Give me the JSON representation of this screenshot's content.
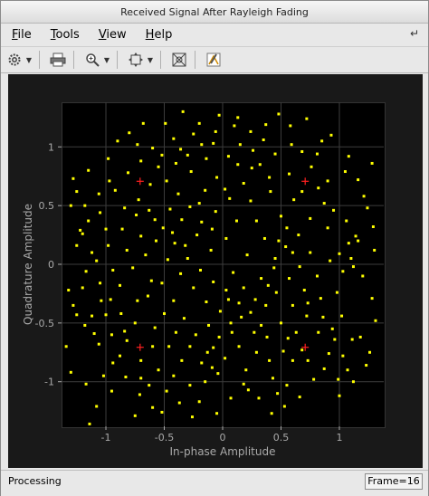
{
  "window": {
    "title": "Received Signal After Rayleigh Fading"
  },
  "menu": [
    {
      "label_u": "F",
      "label_rest": "ile"
    },
    {
      "label_u": "T",
      "label_rest": "ools"
    },
    {
      "label_u": "V",
      "label_rest": "iew"
    },
    {
      "label_u": "H",
      "label_rest": "elp"
    }
  ],
  "toolbar": {
    "icons": [
      "gear-icon",
      "print-icon",
      "zoom-in-icon",
      "fit-to-view-icon",
      "data-cursor-icon",
      "edit-icon"
    ]
  },
  "status": {
    "text": "Processing",
    "frame": "Frame=16"
  },
  "colors": {
    "plot_bg": "#000000",
    "points": "#ffff00",
    "reference": "#ff2020",
    "axis_text": "#aaaaaa"
  },
  "chart_data": {
    "type": "scatter",
    "title": "",
    "xlabel": "In-phase Amplitude",
    "ylabel": "Quadrature Amplitude",
    "xlim": [
      -1.38,
      1.38
    ],
    "ylim": [
      -1.38,
      1.38
    ],
    "xticks": [
      -1,
      -0.5,
      0,
      0.5,
      1
    ],
    "yticks": [
      -1,
      -0.5,
      0,
      0.5,
      1
    ],
    "xtick_labels": [
      "-1",
      "-0.5",
      "0",
      "0.5",
      "1"
    ],
    "ytick_labels": [
      "-1",
      "-0.5",
      "0",
      "0.5",
      "1"
    ],
    "grid": true,
    "reference_points": [
      {
        "x": -0.707,
        "y": 0.707
      },
      {
        "x": 0.707,
        "y": 0.707
      },
      {
        "x": -0.707,
        "y": -0.707
      },
      {
        "x": 0.707,
        "y": -0.707
      }
    ],
    "received_points": [
      [
        -1.28,
        0.73
      ],
      [
        -1.3,
        0.5
      ],
      [
        -1.18,
        0.5
      ],
      [
        -1.22,
        0.29
      ],
      [
        -1.2,
        0.26
      ],
      [
        -1.05,
        0.44
      ],
      [
        -1.0,
        0.3
      ],
      [
        -1.12,
        0.1
      ],
      [
        -1.08,
        0.03
      ],
      [
        -1.17,
        -0.06
      ],
      [
        -1.32,
        -0.22
      ],
      [
        -1.25,
        -0.43
      ],
      [
        -1.1,
        -0.59
      ],
      [
        -1.0,
        -0.43
      ],
      [
        -1.34,
        -0.7
      ],
      [
        -1.3,
        -0.92
      ],
      [
        -1.17,
        -1.02
      ],
      [
        -1.02,
        -0.95
      ],
      [
        -1.14,
        -1.36
      ],
      [
        -1.08,
        -1.21
      ],
      [
        -0.95,
        -1.08
      ],
      [
        -0.88,
        -0.78
      ],
      [
        -0.7,
        -0.82
      ],
      [
        -0.55,
        -0.9
      ],
      [
        -0.7,
        -0.97
      ],
      [
        -0.63,
        -1.03
      ],
      [
        -0.82,
        -0.65
      ],
      [
        -0.52,
        -1.26
      ],
      [
        -0.75,
        -1.29
      ],
      [
        -0.58,
        -0.54
      ],
      [
        -0.46,
        -0.7
      ],
      [
        -0.42,
        -0.95
      ],
      [
        -0.35,
        -0.82
      ],
      [
        -0.28,
        -1.03
      ],
      [
        -0.2,
        -1.17
      ],
      [
        -0.13,
        -0.75
      ],
      [
        -0.09,
        -0.88
      ],
      [
        -0.05,
        -1.27
      ],
      [
        0.02,
        -0.8
      ],
      [
        0.08,
        -0.58
      ],
      [
        0.14,
        -0.7
      ],
      [
        0.2,
        -0.9
      ],
      [
        0.22,
        -1.07
      ],
      [
        0.29,
        -0.75
      ],
      [
        0.33,
        -0.52
      ],
      [
        0.38,
        -0.62
      ],
      [
        0.43,
        -0.97
      ],
      [
        0.47,
        -1.1
      ],
      [
        0.53,
        -1.21
      ],
      [
        0.56,
        -0.63
      ],
      [
        0.6,
        -0.82
      ],
      [
        0.68,
        -0.73
      ],
      [
        0.73,
        -0.82
      ],
      [
        0.82,
        -0.58
      ],
      [
        0.87,
        -0.89
      ],
      [
        0.96,
        -0.64
      ],
      [
        1.03,
        -0.78
      ],
      [
        1.07,
        -0.9
      ],
      [
        1.11,
        -0.64
      ],
      [
        1.0,
        -1.12
      ],
      [
        1.18,
        -0.62
      ],
      [
        1.26,
        -0.75
      ],
      [
        1.02,
        -0.44
      ],
      [
        0.98,
        -0.24
      ],
      [
        1.12,
        -0.02
      ],
      [
        1.2,
        -0.1
      ],
      [
        1.1,
        0.05
      ],
      [
        1.14,
        0.24
      ],
      [
        1.3,
        0.12
      ],
      [
        1.29,
        0.32
      ],
      [
        1.16,
        0.2
      ],
      [
        1.0,
        0.09
      ],
      [
        0.95,
        0.46
      ],
      [
        1.06,
        0.37
      ],
      [
        0.9,
        0.71
      ],
      [
        1.05,
        0.79
      ],
      [
        1.21,
        0.58
      ],
      [
        1.24,
        0.48
      ],
      [
        0.87,
        0.52
      ],
      [
        0.75,
        0.39
      ],
      [
        0.65,
        0.25
      ],
      [
        0.54,
        0.15
      ],
      [
        0.45,
        0.05
      ],
      [
        0.36,
        0.22
      ],
      [
        0.29,
        0.37
      ],
      [
        0.24,
        0.54
      ],
      [
        0.18,
        0.69
      ],
      [
        0.32,
        0.85
      ],
      [
        0.45,
        0.94
      ],
      [
        0.59,
        1.02
      ],
      [
        0.68,
        0.96
      ],
      [
        0.76,
        0.83
      ],
      [
        0.82,
        0.65
      ],
      [
        0.9,
        0.31
      ],
      [
        0.61,
        0.55
      ],
      [
        0.5,
        0.41
      ],
      [
        0.41,
        0.62
      ],
      [
        0.35,
        1.06
      ],
      [
        0.24,
        1.13
      ],
      [
        0.1,
        1.18
      ],
      [
        -0.03,
        1.27
      ],
      [
        -0.08,
        1.03
      ],
      [
        -0.14,
        0.9
      ],
      [
        -0.25,
        1.11
      ],
      [
        -0.36,
        0.98
      ],
      [
        -0.49,
        1.2
      ],
      [
        -0.6,
        0.99
      ],
      [
        -0.7,
        0.88
      ],
      [
        -0.81,
        0.78
      ],
      [
        -0.92,
        0.63
      ],
      [
        -0.84,
        0.48
      ],
      [
        -0.72,
        0.55
      ],
      [
        -0.63,
        0.46
      ],
      [
        -0.51,
        0.31
      ],
      [
        -0.41,
        0.18
      ],
      [
        -0.3,
        0.05
      ],
      [
        -0.19,
        -0.05
      ],
      [
        -0.08,
        -0.15
      ],
      [
        0.03,
        -0.22
      ],
      [
        0.14,
        -0.33
      ],
      [
        0.24,
        -0.41
      ],
      [
        0.37,
        -0.35
      ],
      [
        0.46,
        -0.24
      ],
      [
        0.57,
        -0.12
      ],
      [
        0.66,
        -0.02
      ],
      [
        0.75,
        0.1
      ],
      [
        0.84,
        -0.29
      ],
      [
        0.72,
        -0.44
      ],
      [
        0.6,
        -0.35
      ],
      [
        0.5,
        -0.5
      ],
      [
        -0.06,
        0.45
      ],
      [
        -0.18,
        0.36
      ],
      [
        -0.28,
        0.49
      ],
      [
        -0.38,
        0.6
      ],
      [
        -0.48,
        0.71
      ],
      [
        -0.27,
        0.79
      ],
      [
        -0.15,
        0.63
      ],
      [
        -0.05,
        0.74
      ],
      [
        0.06,
        0.56
      ],
      [
        0.12,
        0.37
      ],
      [
        0.03,
        0.22
      ],
      [
        -0.1,
        0.12
      ],
      [
        -0.22,
        0.25
      ],
      [
        -0.35,
        0.38
      ],
      [
        -0.45,
        0.47
      ],
      [
        -0.57,
        0.2
      ],
      [
        -0.66,
        0.08
      ],
      [
        -0.77,
        -0.03
      ],
      [
        -0.88,
        -0.18
      ],
      [
        -0.96,
        -0.3
      ],
      [
        -0.87,
        -0.42
      ],
      [
        -0.75,
        -0.5
      ],
      [
        -0.64,
        -0.27
      ],
      [
        -0.52,
        -0.16
      ],
      [
        -0.42,
        -0.31
      ],
      [
        -0.33,
        -0.46
      ],
      [
        -0.23,
        -0.6
      ],
      [
        -0.12,
        -0.52
      ],
      [
        -0.02,
        -0.4
      ],
      [
        0.09,
        -0.07
      ],
      [
        0.21,
        0.08
      ],
      [
        0.33,
        -0.12
      ],
      [
        0.44,
        -0.03
      ],
      [
        0.55,
        0.31
      ],
      [
        0.68,
        0.62
      ],
      [
        0.81,
        0.94
      ],
      [
        0.93,
        1.1
      ],
      [
        0.72,
        1.24
      ],
      [
        0.58,
        1.18
      ],
      [
        0.48,
        1.28
      ],
      [
        0.05,
        0.92
      ],
      [
        0.15,
        1.02
      ],
      [
        -0.2,
        1.2
      ],
      [
        -0.42,
        1.07
      ],
      [
        -0.55,
        0.83
      ],
      [
        -0.97,
        0.71
      ],
      [
        -1.06,
        0.6
      ],
      [
        -1.15,
        0.8
      ],
      [
        -1.25,
        0.62
      ],
      [
        -0.98,
        0.9
      ],
      [
        -0.9,
        1.05
      ],
      [
        -0.8,
        1.12
      ],
      [
        -0.68,
        1.2
      ],
      [
        -0.34,
        1.3
      ],
      [
        -0.62,
        0.68
      ],
      [
        -0.4,
        0.86
      ],
      [
        0.25,
        0.82
      ],
      [
        0.4,
        0.74
      ],
      [
        0.57,
        0.77
      ],
      [
        0.85,
        1.05
      ],
      [
        1.08,
        0.92
      ],
      [
        1.16,
        0.72
      ],
      [
        1.28,
        0.86
      ],
      [
        -1.2,
        -0.2
      ],
      [
        -1.05,
        -0.16
      ],
      [
        -0.94,
        -0.05
      ],
      [
        -0.82,
        0.12
      ],
      [
        -0.7,
        0.24
      ],
      [
        -0.58,
        0.38
      ],
      [
        -0.47,
        0.04
      ],
      [
        -0.36,
        -0.08
      ],
      [
        -0.25,
        -0.2
      ],
      [
        -0.14,
        -0.32
      ],
      [
        -0.03,
        -0.62
      ],
      [
        0.07,
        -0.5
      ],
      [
        0.18,
        -0.2
      ],
      [
        0.28,
        -0.3
      ],
      [
        0.39,
        -0.18
      ],
      [
        0.48,
        0.2
      ],
      [
        0.6,
        0.1
      ],
      [
        0.7,
        -0.22
      ],
      [
        0.81,
        -0.1
      ],
      [
        0.92,
        0.03
      ],
      [
        1.03,
        -0.06
      ],
      [
        1.08,
        0.18
      ],
      [
        -0.98,
        0.16
      ],
      [
        -0.86,
        0.3
      ],
      [
        -0.74,
        0.42
      ],
      [
        -1.15,
        0.37
      ],
      [
        -1.25,
        0.16
      ],
      [
        -1.28,
        -0.35
      ],
      [
        -1.18,
        -0.52
      ],
      [
        -1.06,
        -0.68
      ],
      [
        -0.94,
        -0.84
      ],
      [
        -0.83,
        -0.96
      ],
      [
        -0.71,
        -1.11
      ],
      [
        -0.6,
        -1.22
      ],
      [
        -0.48,
        -1.08
      ],
      [
        -0.37,
        -1.18
      ],
      [
        -0.26,
        -1.3
      ],
      [
        -0.15,
        -1.0
      ],
      [
        -0.04,
        -0.93
      ],
      [
        0.07,
        -1.14
      ],
      [
        0.18,
        -1.02
      ],
      [
        0.31,
        -1.14
      ],
      [
        0.42,
        -1.27
      ],
      [
        0.55,
        -1.03
      ],
      [
        0.66,
        -1.13
      ],
      [
        0.78,
        -0.98
      ],
      [
        0.91,
        -0.76
      ],
      [
        0.99,
        -0.98
      ],
      [
        1.12,
        -1.0
      ],
      [
        1.23,
        -0.86
      ],
      [
        1.31,
        -0.48
      ],
      [
        1.28,
        -0.29
      ],
      [
        -0.6,
        -0.7
      ],
      [
        -0.4,
        -0.58
      ],
      [
        -0.28,
        -0.7
      ],
      [
        -0.18,
        -0.84
      ],
      [
        -0.08,
        -0.71
      ],
      [
        0.05,
        -0.3
      ],
      [
        0.16,
        -0.45
      ],
      [
        0.27,
        -0.58
      ],
      [
        0.4,
        -0.82
      ],
      [
        0.52,
        -0.74
      ],
      [
        0.63,
        -0.58
      ],
      [
        0.73,
        -0.33
      ],
      [
        0.86,
        -0.45
      ],
      [
        0.94,
        -0.55
      ],
      [
        -0.5,
        -0.42
      ],
      [
        -0.61,
        -0.14
      ],
      [
        -0.73,
        -0.31
      ],
      [
        -0.84,
        -0.57
      ],
      [
        -0.95,
        -0.6
      ],
      [
        -1.04,
        -0.31
      ],
      [
        -1.12,
        -0.44
      ],
      [
        -0.43,
        0.27
      ],
      [
        -0.32,
        0.16
      ],
      [
        -0.2,
        0.52
      ],
      [
        -0.09,
        0.3
      ],
      [
        0.02,
        0.64
      ],
      [
        0.13,
        0.85
      ],
      [
        0.26,
        0.97
      ],
      [
        0.37,
        1.19
      ],
      [
        0.13,
        1.25
      ],
      [
        -0.06,
        1.13
      ],
      [
        -0.18,
        1.02
      ],
      [
        -0.3,
        0.93
      ],
      [
        -0.52,
        0.93
      ],
      [
        -0.73,
        1.02
      ]
    ]
  }
}
